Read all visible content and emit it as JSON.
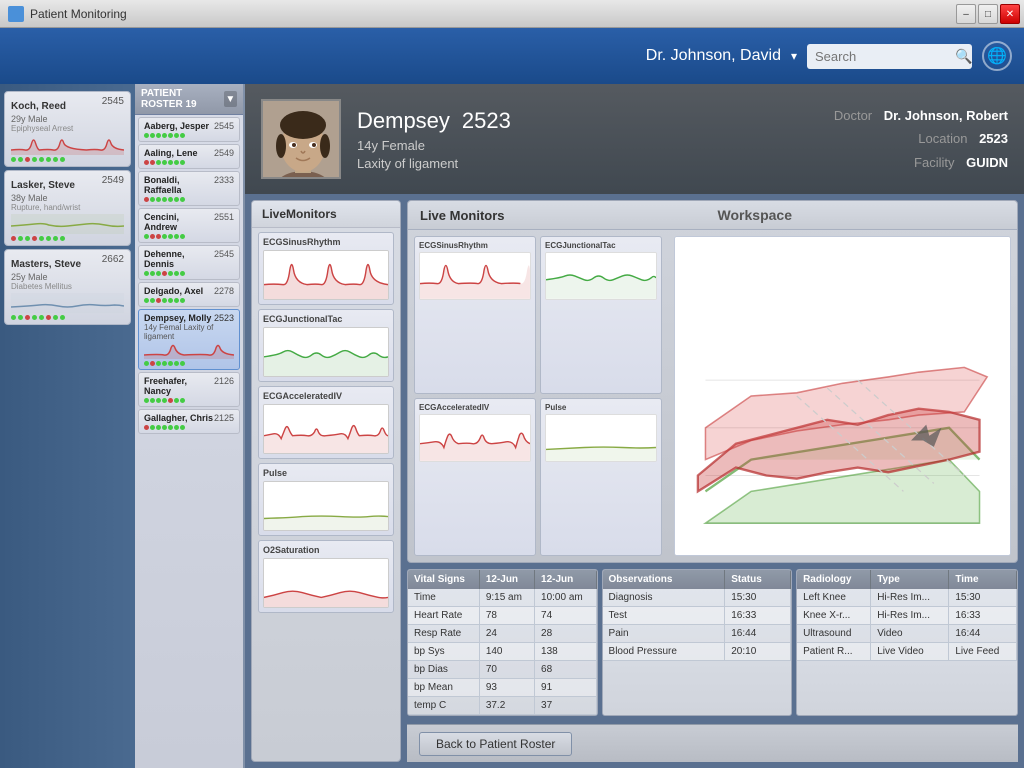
{
  "app": {
    "title": "Patient Monitoring",
    "window_controls": {
      "minimize": "–",
      "maximize": "□",
      "close": "✕"
    }
  },
  "header": {
    "doctor_name": "Dr. Johnson, David",
    "dropdown_icon": "▾",
    "search_placeholder": "Search",
    "globe_icon": "🌐"
  },
  "sidebar": {
    "patients": [
      {
        "name": "Koch, Reed",
        "id": "2545",
        "info": "29y Male",
        "condition": "Epiphyseal Arrest",
        "dots": [
          "green",
          "green",
          "red",
          "green",
          "green",
          "green",
          "green",
          "green"
        ]
      },
      {
        "name": "Lasker, Steve",
        "id": "2549",
        "info": "38y Male",
        "condition": "Rupture, hand/wrist",
        "dots": [
          "red",
          "green",
          "green",
          "red",
          "green",
          "green",
          "green",
          "green"
        ]
      },
      {
        "name": "Masters, Steve",
        "id": "2662",
        "info": "25y Male",
        "condition": "Diabetes Mellitus",
        "dots": [
          "green",
          "green",
          "red",
          "green",
          "green",
          "red",
          "green",
          "green"
        ]
      }
    ]
  },
  "roster": {
    "title": "PATIENT ROSTER",
    "count": 19,
    "patients": [
      {
        "name": "Aaberg, Jesper",
        "id": "2545",
        "dots": [
          "green",
          "green",
          "green",
          "green",
          "green",
          "green",
          "green"
        ]
      },
      {
        "name": "Aaling, Lene",
        "id": "2549",
        "dots": [
          "red",
          "red",
          "green",
          "green",
          "green",
          "green",
          "green"
        ]
      },
      {
        "name": "Bonaldi, Raffaella",
        "id": "2333",
        "dots": [
          "red",
          "green",
          "green",
          "green",
          "green",
          "green",
          "green"
        ]
      },
      {
        "name": "Cencini, Andrew",
        "id": "2551",
        "dots": [
          "green",
          "red",
          "red",
          "green",
          "green",
          "green",
          "green"
        ]
      },
      {
        "name": "Dehenne, Dennis",
        "id": "2545",
        "dots": [
          "green",
          "green",
          "green",
          "red",
          "green",
          "green",
          "green"
        ]
      },
      {
        "name": "Delgado, Axel",
        "id": "2278",
        "dots": [
          "green",
          "green",
          "red",
          "green",
          "green",
          "green",
          "green"
        ]
      },
      {
        "name": "Dempsey, Molly",
        "id": "2523",
        "dots": [
          "green",
          "red",
          "green",
          "green",
          "green",
          "green",
          "green"
        ]
      },
      {
        "name": "Freehafer, Nancy",
        "id": "2126",
        "dots": [
          "green",
          "green",
          "green",
          "green",
          "red",
          "green",
          "green"
        ]
      },
      {
        "name": "Gallagher, Chris",
        "id": "2125",
        "dots": [
          "red",
          "green",
          "green",
          "green",
          "green",
          "green",
          "green"
        ]
      }
    ]
  },
  "patient": {
    "first_name": "Dempsey",
    "id": "2523",
    "age_gender": "14y Female",
    "condition": "Laxity of ligament",
    "doctor_label": "Doctor",
    "doctor_value": "Dr. Johnson, Robert",
    "location_label": "Location",
    "location_value": "2523",
    "facility_label": "Facility",
    "facility_value": "GUIDN"
  },
  "live_monitors_panel": {
    "title": "LiveMonitors",
    "items": [
      {
        "title": "ECGSinusRhythm"
      },
      {
        "title": "ECGJunctionalTac"
      },
      {
        "title": "ECGAcceleratedIV"
      },
      {
        "title": "Pulse"
      },
      {
        "title": "O2Saturation"
      }
    ]
  },
  "live_monitors_grid": {
    "title": "Live Monitors",
    "workspace_label": "Workspace",
    "items": [
      {
        "title": "ECGSinusRhythm"
      },
      {
        "title": "ECGJunctionalTac"
      },
      {
        "title": "ECGAcceleratedIV"
      },
      {
        "title": "Pulse"
      }
    ]
  },
  "vital_signs": {
    "title": "Vital Signs",
    "col1": "12-Jun",
    "col2": "12-Jun",
    "rows": [
      {
        "label": "Time",
        "val1": "9:15 am",
        "val2": "10:00 am"
      },
      {
        "label": "Heart Rate",
        "val1": "78",
        "val2": "74"
      },
      {
        "label": "Resp Rate",
        "val1": "24",
        "val2": "28"
      },
      {
        "label": "bp Sys",
        "val1": "140",
        "val2": "138"
      },
      {
        "label": "bp Dias",
        "val1": "70",
        "val2": "68"
      },
      {
        "label": "bp Mean",
        "val1": "93",
        "val2": "91"
      },
      {
        "label": "temp C",
        "val1": "37.2",
        "val2": "37"
      }
    ]
  },
  "observations": {
    "col1": "Observations",
    "col2": "Status",
    "rows": [
      {
        "label": "Diagnosis",
        "status": "15:30"
      },
      {
        "label": "Test",
        "status": "16:33"
      },
      {
        "label": "Pain",
        "status": "16:44"
      },
      {
        "label": "Blood Pressure",
        "status": "20:10"
      }
    ]
  },
  "radiology": {
    "col1": "Radiology",
    "col2": "Type",
    "col3": "Time",
    "rows": [
      {
        "label": "Left Knee",
        "type": "Hi-Res Im...",
        "time": "15:30"
      },
      {
        "label": "Knee X-r...",
        "type": "Hi-Res Im...",
        "time": "16:33"
      },
      {
        "label": "Ultrasound",
        "type": "Video",
        "time": "16:44"
      },
      {
        "label": "Patient R...",
        "type": "Live Video",
        "time": "Live Feed"
      }
    ]
  },
  "back_button": "Back to Patient Roster"
}
